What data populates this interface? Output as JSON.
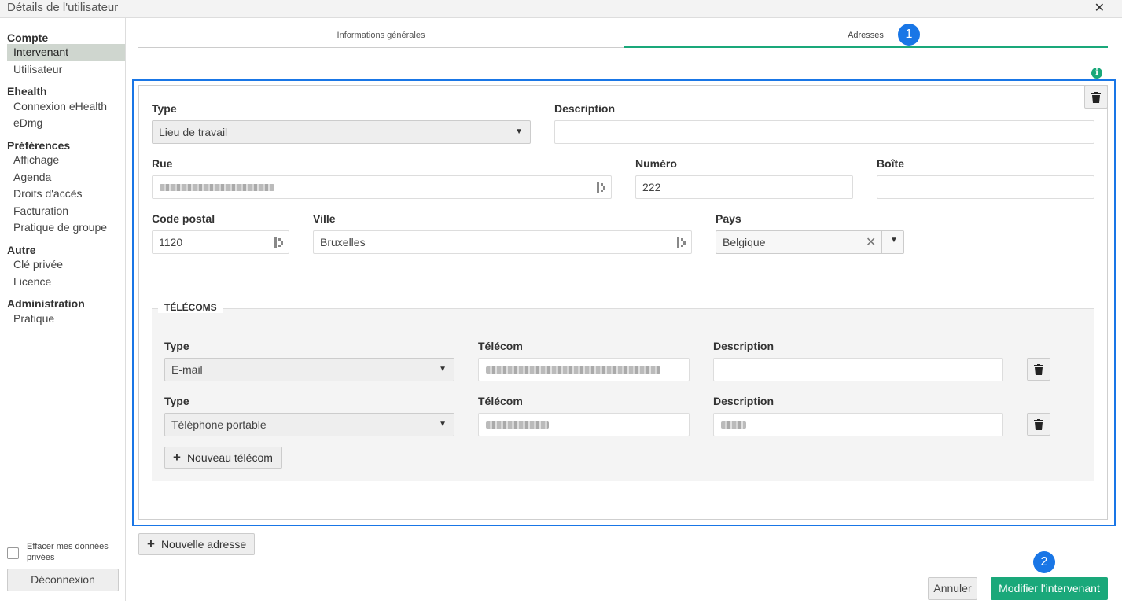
{
  "window": {
    "title": "Détails de l'utilisateur",
    "close_glyph": "✕"
  },
  "sidebar": {
    "sections": [
      {
        "heading": "Compte",
        "items": [
          "Intervenant",
          "Utilisateur"
        ]
      },
      {
        "heading": "Ehealth",
        "items": [
          "Connexion eHealth",
          "eDmg"
        ]
      },
      {
        "heading": "Préférences",
        "items": [
          "Affichage",
          "Agenda",
          "Droits d'accès",
          "Facturation",
          "Pratique de groupe"
        ]
      },
      {
        "heading": "Autre",
        "items": [
          "Clé privée",
          "Licence"
        ]
      },
      {
        "heading": "Administration",
        "items": [
          "Pratique"
        ]
      }
    ],
    "active_item": "Intervenant",
    "erase_label": "Effacer mes données privées",
    "erase_checked": false,
    "logout_label": "Déconnexion"
  },
  "tabs": [
    {
      "label": "Informations générales",
      "active": false
    },
    {
      "label": "Adresses",
      "active": true
    }
  ],
  "markers": [
    "1",
    "2"
  ],
  "info_glyph": "i",
  "address": {
    "type_label": "Type",
    "type_value": "Lieu de travail",
    "description_label": "Description",
    "description_value": "",
    "rue_label": "Rue",
    "rue_value": "(masqué)",
    "numero_label": "Numéro",
    "numero_value": "222",
    "boite_label": "Boîte",
    "boite_value": "",
    "cp_label": "Code postal",
    "cp_value": "1120",
    "ville_label": "Ville",
    "ville_value": "Bruxelles",
    "pays_label": "Pays",
    "pays_value": "Belgique",
    "pays_clear_glyph": "✕"
  },
  "telecoms": {
    "title": "TÉLÉCOMS",
    "rows": [
      {
        "type_label": "Type",
        "type_value": "E-mail",
        "telecom_label": "Télécom",
        "telecom_value": "(masqué)",
        "description_label": "Description",
        "description_value": ""
      },
      {
        "type_label": "Type",
        "type_value": "Téléphone portable",
        "telecom_label": "Télécom",
        "telecom_value": "(masqué)",
        "description_label": "Description",
        "description_value": "(masqué)"
      }
    ],
    "add_label": "Nouveau télécom"
  },
  "buttons": {
    "new_address": "Nouvelle adresse",
    "cancel": "Annuler",
    "save": "Modifier l'intervenant",
    "plus_glyph": "+"
  },
  "colors": {
    "accent_green": "#1aa87a",
    "marker_blue": "#1976e6",
    "active_item_bg": "#cfd6cf"
  },
  "icons": [
    "close-icon",
    "info-icon",
    "trash-icon",
    "caret-down-icon",
    "address-book-icon",
    "plus-icon",
    "checkbox-icon"
  ]
}
